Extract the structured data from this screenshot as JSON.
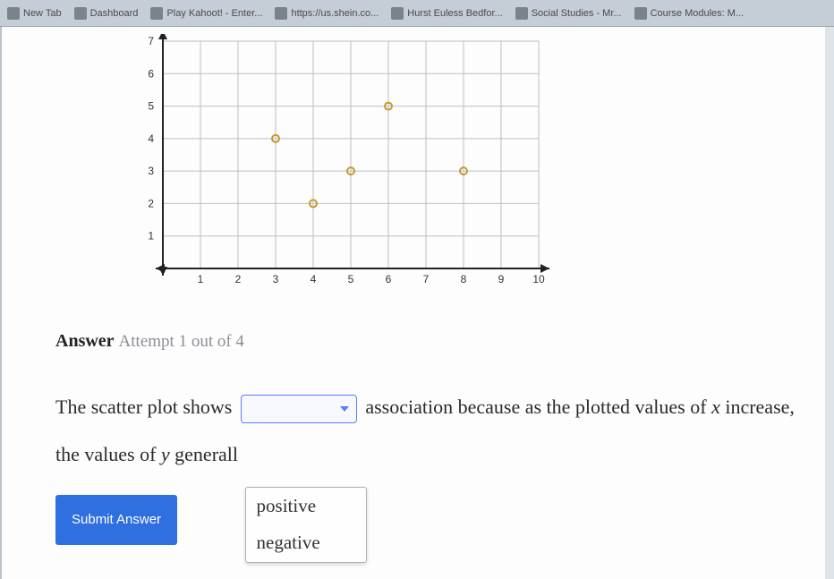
{
  "bookmarks": [
    {
      "label": "New Tab"
    },
    {
      "label": "Dashboard"
    },
    {
      "label": "Play Kahoot! - Enter..."
    },
    {
      "label": "https://us.shein.co..."
    },
    {
      "label": "Hurst Euless Bedfor..."
    },
    {
      "label": "Social Studies - Mr..."
    },
    {
      "label": "Course Modules: M..."
    }
  ],
  "answer": {
    "heading_bold": "Answer",
    "heading_light": "Attempt 1 out of 4",
    "text_before_dd1": "The scatter plot shows",
    "text_after_dd1": "association because as the plotted values of",
    "var_x": "x",
    "text_after_x": "increase,",
    "line2_before": "the values of",
    "var_y": "y",
    "line2_after": "generall",
    "dropdown_options": [
      "positive",
      "negative"
    ],
    "submit_label": "Submit Answer"
  },
  "chart_data": {
    "type": "scatter",
    "title": "",
    "points": [
      {
        "x": 3,
        "y": 4
      },
      {
        "x": 4,
        "y": 2
      },
      {
        "x": 5,
        "y": 3
      },
      {
        "x": 6,
        "y": 5
      },
      {
        "x": 8,
        "y": 3
      }
    ],
    "xlabel": "",
    "ylabel": "",
    "xlim": [
      0,
      10
    ],
    "ylim": [
      0,
      7
    ],
    "x_ticks": [
      1,
      2,
      3,
      4,
      5,
      6,
      7,
      8,
      9,
      10
    ],
    "y_ticks": [
      1,
      2,
      3,
      4,
      5,
      6,
      7
    ],
    "grid": true
  }
}
